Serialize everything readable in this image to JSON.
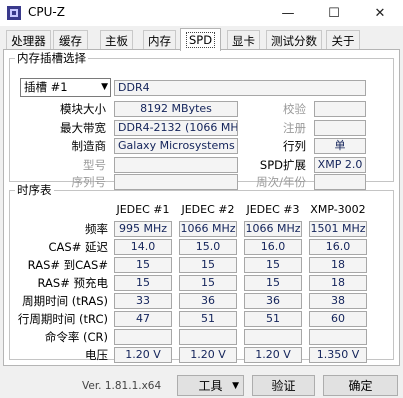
{
  "window": {
    "title": "CPU-Z",
    "minimize": "—",
    "maximize": "☐",
    "close": "✕"
  },
  "tabs": [
    "处理器",
    "缓存",
    "主板",
    "内存",
    "SPD",
    "显卡",
    "测试分数",
    "关于"
  ],
  "active_tab": "SPD",
  "slot_group": {
    "title": "内存插槽选择",
    "slot_selected": "插槽 #1",
    "memory_type": "DDR4",
    "labels": {
      "module_size": "模块大小",
      "max_bandwidth": "最大带宽",
      "manufacturer": "制造商",
      "part_number": "型号",
      "serial_number": "序列号",
      "correction": "校验",
      "registered": "注册",
      "ranks": "行列",
      "spd_ext": "SPD扩展",
      "week_year": "周次/年份"
    },
    "values": {
      "module_size": "8192 MBytes",
      "max_bandwidth": "DDR4-2132 (1066 MHz)",
      "manufacturer": "Galaxy Microsystems Ltd.",
      "part_number": "",
      "serial_number": "",
      "correction": "",
      "registered": "",
      "ranks": "单",
      "spd_ext": "XMP 2.0",
      "week_year": ""
    }
  },
  "timing_group": {
    "title": "时序表",
    "columns": [
      "JEDEC #1",
      "JEDEC #2",
      "JEDEC #3",
      "XMP-3002"
    ],
    "rows": [
      {
        "label": "频率",
        "values": [
          "995 MHz",
          "1066 MHz",
          "1066 MHz",
          "1501 MHz"
        ]
      },
      {
        "label": "CAS# 延迟",
        "values": [
          "14.0",
          "15.0",
          "16.0",
          "16.0"
        ]
      },
      {
        "label": "RAS# 到CAS#",
        "values": [
          "15",
          "15",
          "15",
          "18"
        ]
      },
      {
        "label": "RAS# 预充电",
        "values": [
          "15",
          "15",
          "15",
          "18"
        ]
      },
      {
        "label": "周期时间 (tRAS)",
        "values": [
          "33",
          "36",
          "36",
          "38"
        ]
      },
      {
        "label": "行周期时间 (tRC)",
        "values": [
          "47",
          "51",
          "51",
          "60"
        ]
      },
      {
        "label": "命令率 (CR)",
        "values": [
          "",
          "",
          "",
          ""
        ]
      },
      {
        "label": "电压",
        "values": [
          "1.20 V",
          "1.20 V",
          "1.20 V",
          "1.350 V"
        ]
      }
    ]
  },
  "footer": {
    "version": "Ver. 1.81.1.x64",
    "tools": "工具",
    "validate": "验证",
    "ok": "确定"
  }
}
